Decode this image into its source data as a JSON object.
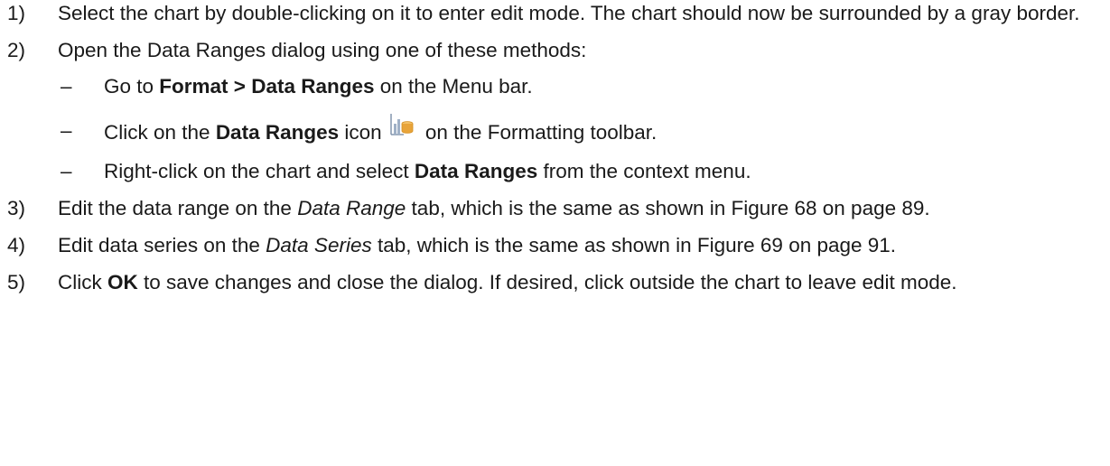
{
  "steps": [
    {
      "num": "1)",
      "text": "Select the chart by double-clicking on it to enter edit mode. The chart should now be surrounded by a gray border."
    },
    {
      "num": "2)",
      "text": "Open the Data Ranges dialog using one of these methods:",
      "sub": [
        {
          "dash": "–",
          "pre": "Go to ",
          "bold": "Format > Data Ranges",
          "post": " on the Menu bar."
        },
        {
          "dash": "–",
          "pre": "Click on the ",
          "bold": "Data Ranges",
          "mid": " icon",
          "icon": "data-ranges-icon",
          "post": " on the Formatting toolbar."
        },
        {
          "dash": "–",
          "pre": "Right-click on the chart and select ",
          "bold": "Data Ranges",
          "post": " from the context menu."
        }
      ]
    },
    {
      "num": "3)",
      "pre": "Edit the data range on the ",
      "italic": "Data Range",
      "post": " tab, which is the same as shown in Figure 68 on page 89."
    },
    {
      "num": "4)",
      "pre": "Edit data series on the ",
      "italic": "Data Series",
      "post": " tab, which is the same as shown in Figure 69 on page 91."
    },
    {
      "num": "5)",
      "pre": "Click ",
      "bold": "OK",
      "post": " to save changes and close the dialog. If desired, click outside the chart to leave edit mode."
    }
  ],
  "colors": {
    "text": "#1a1a1a",
    "icon_chart_line": "#7a8ea8",
    "icon_database": "#e8a43a"
  }
}
